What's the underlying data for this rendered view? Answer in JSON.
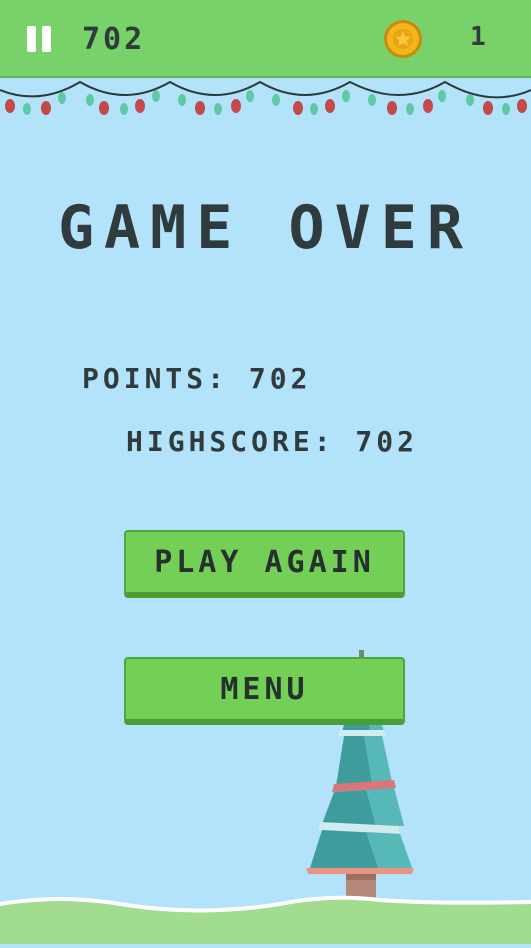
{
  "hud": {
    "score": "702",
    "coins": "1",
    "pause_icon": "pause-icon",
    "coin_icon": "coin-icon"
  },
  "game_over": {
    "title": "GAME OVER",
    "points_label": "POINTS: 702",
    "highscore_label": "HIGHSCORE: 702"
  },
  "buttons": {
    "play_again": "PLAY AGAIN",
    "menu": "MENU"
  },
  "colors": {
    "sky": "#b3e3fb",
    "topbar": "#79d16a",
    "button": "#74cf56",
    "text": "#2f3b3d",
    "coin": "#f2b51b"
  }
}
